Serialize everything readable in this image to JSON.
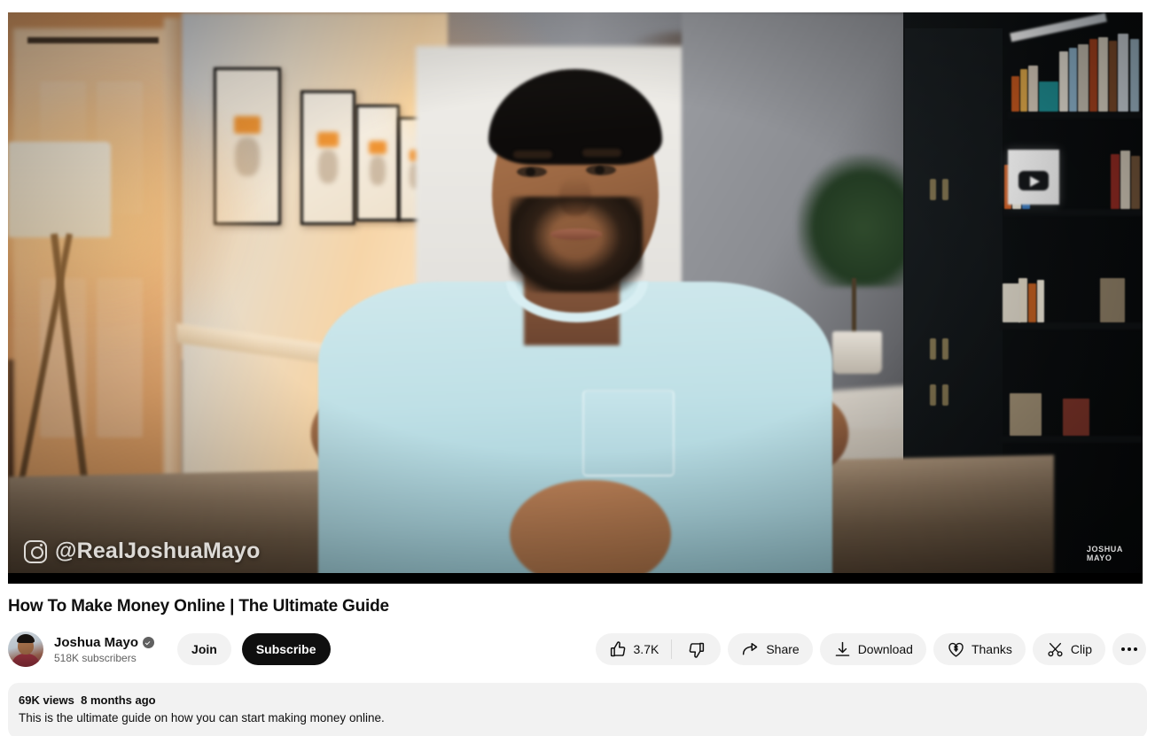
{
  "player": {
    "instagram_watermark": "@RealJoshuaMayo",
    "corner_logo_line1": "JOSHUA",
    "corner_logo_line2": "MAYO"
  },
  "video": {
    "title": "How To Make Money Online | The Ultimate Guide",
    "views": "69K views",
    "published": "8 months ago",
    "description": "This is the ultimate guide on how you can start making money online."
  },
  "channel": {
    "name": "Joshua Mayo",
    "subscribers": "518K subscribers",
    "join_label": "Join",
    "subscribe_label": "Subscribe"
  },
  "actions": {
    "like_count": "3.7K",
    "share_label": "Share",
    "download_label": "Download",
    "thanks_label": "Thanks",
    "clip_label": "Clip"
  },
  "colors": {
    "pill_bg": "#f2f2f2",
    "text_primary": "#0f0f0f",
    "text_secondary": "#606060",
    "subscribe_bg": "#0f0f0f"
  }
}
